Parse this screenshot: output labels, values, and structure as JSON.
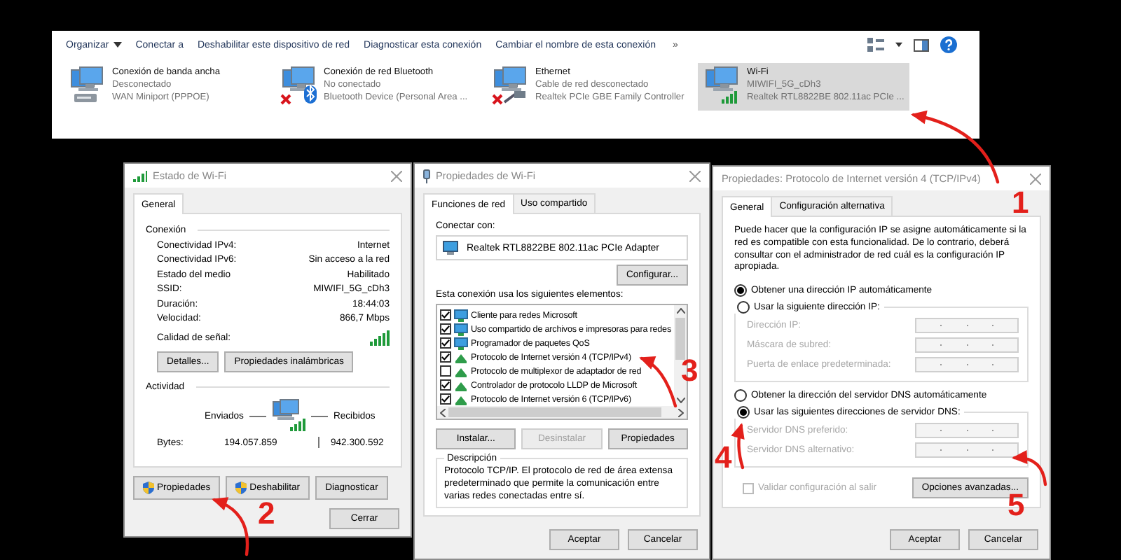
{
  "toolbar": {
    "items": [
      {
        "label": "Organizar",
        "dropdown": true
      },
      {
        "label": "Conectar a",
        "dropdown": false
      },
      {
        "label": "Deshabilitar este dispositivo de red",
        "dropdown": false
      },
      {
        "label": "Diagnosticar esta conexión",
        "dropdown": false
      },
      {
        "label": "Cambiar el nombre de esta conexión",
        "dropdown": false
      }
    ],
    "more": "»"
  },
  "connections": [
    {
      "name": "Conexión de banda ancha",
      "status": "Desconectado",
      "device": "WAN Miniport (PPPOE)",
      "kind": "broadband",
      "disconnected": false,
      "selected": false
    },
    {
      "name": "Conexión de red Bluetooth",
      "status": "No conectado",
      "device": "Bluetooth Device (Personal Area ...",
      "kind": "bluetooth",
      "disconnected": true,
      "selected": false
    },
    {
      "name": "Ethernet",
      "status": "Cable de red desconectado",
      "device": "Realtek PCIe GBE Family Controller",
      "kind": "ethernet",
      "disconnected": true,
      "selected": false
    },
    {
      "name": "Wi-Fi",
      "status": "MIWIFI_5G_cDh3",
      "device": "Realtek RTL8822BE 802.11ac PCIe ...",
      "kind": "wifi",
      "disconnected": false,
      "selected": true
    }
  ],
  "status_window": {
    "title": "Estado de Wi-Fi",
    "tabs": [
      {
        "label": "General",
        "selected": true
      }
    ],
    "connection_heading": "Conexión",
    "rows": [
      {
        "label": "Conectividad IPv4:",
        "value": "Internet"
      },
      {
        "label": "Conectividad IPv6:",
        "value": "Sin acceso a la red"
      },
      {
        "label": "Estado del medio",
        "value": "Habilitado"
      },
      {
        "label": "SSID:",
        "value": "MIWIFI_5G_cDh3"
      },
      {
        "label": "Duración:",
        "value": "18:44:03"
      },
      {
        "label": "Velocidad:",
        "value": "866,7 Mbps"
      }
    ],
    "signal_label": "Calidad de señal:",
    "detail_buttons": [
      "Detalles...",
      "Propiedades inalámbricas"
    ],
    "activity_heading": "Actividad",
    "sent_label": "Enviados",
    "received_label": "Recibidos",
    "bytes_label": "Bytes:",
    "bytes_sent": "194.057.859",
    "bytes_received": "942.300.592",
    "action_buttons": [
      {
        "label": "Propiedades",
        "shield": true
      },
      {
        "label": "Deshabilitar",
        "shield": true
      },
      {
        "label": "Diagnosticar",
        "shield": false
      }
    ],
    "close_button": "Cerrar"
  },
  "properties_window": {
    "title": "Propiedades de Wi-Fi",
    "tabs": [
      {
        "label": "Funciones de red",
        "selected": true
      },
      {
        "label": "Uso compartido",
        "selected": false
      }
    ],
    "connect_label": "Conectar con:",
    "adapter": "Realtek RTL8822BE 802.11ac PCIe Adapter",
    "configure_button": "Configurar...",
    "items_label": "Esta conexión usa los siguientes elementos:",
    "items": [
      {
        "label": "Cliente para redes Microsoft",
        "checked": true,
        "kind": "service"
      },
      {
        "label": "Uso compartido de archivos e impresoras para redes",
        "checked": true,
        "kind": "service"
      },
      {
        "label": "Programador de paquetes QoS",
        "checked": true,
        "kind": "service"
      },
      {
        "label": "Protocolo de Internet versión 4 (TCP/IPv4)",
        "checked": true,
        "kind": "protocol"
      },
      {
        "label": "Protocolo de multiplexor de adaptador de red",
        "checked": false,
        "kind": "protocol"
      },
      {
        "label": "Controlador de protocolo LLDP de Microsoft",
        "checked": true,
        "kind": "protocol"
      },
      {
        "label": "Protocolo de Internet versión 6 (TCP/IPv6)",
        "checked": true,
        "kind": "protocol"
      }
    ],
    "buttons": [
      {
        "label": "Instalar...",
        "disabled": false
      },
      {
        "label": "Desinstalar",
        "disabled": true
      },
      {
        "label": "Propiedades",
        "disabled": false
      }
    ],
    "description_title": "Descripción",
    "description": "Protocolo TCP/IP. El protocolo de red de área extensa predeterminado que permite la comunicación entre varias redes conectadas entre sí.",
    "footer_buttons": [
      "Aceptar",
      "Cancelar"
    ]
  },
  "ipv4_window": {
    "title": "Propiedades: Protocolo de Internet versión 4 (TCP/IPv4)",
    "tabs": [
      {
        "label": "General",
        "selected": true
      },
      {
        "label": "Configuración alternativa",
        "selected": false
      }
    ],
    "intro": "Puede hacer que la configuración IP se asigne automáticamente si la red es compatible con esta funcionalidad. De lo contrario, deberá consultar con el administrador de red cuál es la configuración IP apropiada.",
    "ip_options": [
      {
        "label": "Obtener una dirección IP automáticamente",
        "selected": true
      },
      {
        "label": "Usar la siguiente dirección IP:",
        "selected": false
      }
    ],
    "ip_fields": [
      {
        "label": "Dirección IP:",
        "disabled": true
      },
      {
        "label": "Máscara de subred:",
        "disabled": true
      },
      {
        "label": "Puerta de enlace predeterminada:",
        "disabled": true
      }
    ],
    "dns_options": [
      {
        "label": "Obtener la dirección del servidor DNS automáticamente",
        "selected": false
      },
      {
        "label": "Usar las siguientes direcciones de servidor DNS:",
        "selected": true
      }
    ],
    "dns_fields": [
      {
        "label": "Servidor DNS preferido:",
        "disabled": true
      },
      {
        "label": "Servidor DNS alternativo:",
        "disabled": true
      }
    ],
    "validate": {
      "label": "Validar configuración al salir",
      "checked": false,
      "disabled": true
    },
    "advanced_button": "Opciones avanzadas...",
    "footer_buttons": [
      "Aceptar",
      "Cancelar"
    ]
  },
  "annotations": [
    {
      "label": "1"
    },
    {
      "label": "2"
    },
    {
      "label": "3"
    },
    {
      "label": "4"
    },
    {
      "label": "5"
    }
  ]
}
